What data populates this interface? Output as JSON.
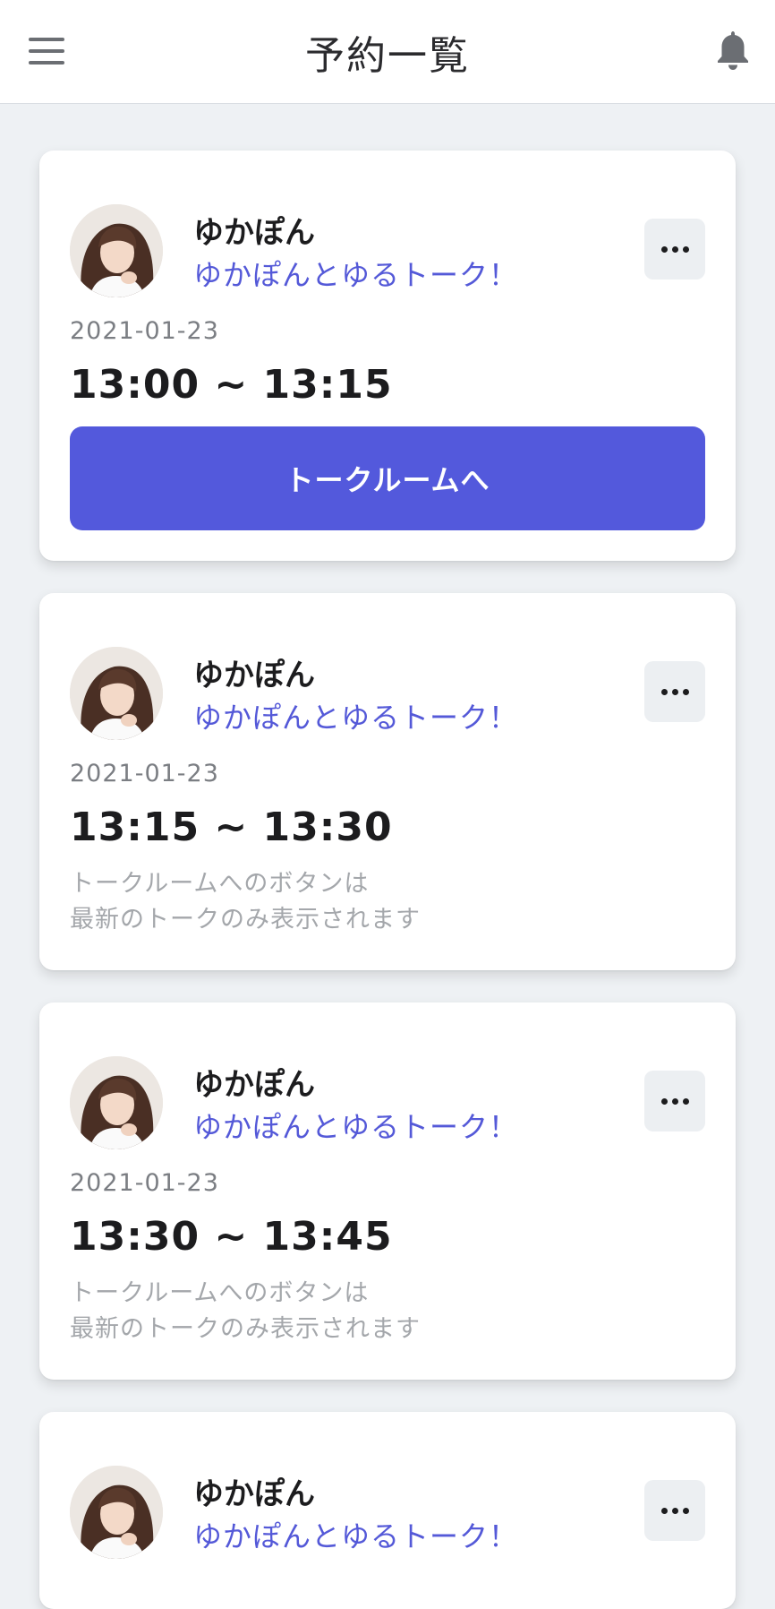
{
  "header": {
    "title": "予約一覧",
    "menu_icon": "hamburger-menu-icon",
    "bell_icon": "bell-icon"
  },
  "colors": {
    "accent": "#5359dc",
    "background": "#eef1f4",
    "card": "#ffffff"
  },
  "reservations": [
    {
      "host": "ゆかぽん",
      "title": "ゆかぽんとゆるトーク！",
      "date": "2021-01-23",
      "time": "13:00 ~ 13:15",
      "button_label": "トークルームへ"
    },
    {
      "host": "ゆかぽん",
      "title": "ゆかぽんとゆるトーク！",
      "date": "2021-01-23",
      "time": "13:15 ~ 13:30",
      "note_line1": "トークルームへのボタンは",
      "note_line2": "最新のトークのみ表示されます"
    },
    {
      "host": "ゆかぽん",
      "title": "ゆかぽんとゆるトーク！",
      "date": "2021-01-23",
      "time": "13:30 ~ 13:45",
      "note_line1": "トークルームへのボタンは",
      "note_line2": "最新のトークのみ表示されます"
    },
    {
      "host": "ゆかぽん",
      "title": "ゆかぽんとゆるトーク！"
    }
  ]
}
